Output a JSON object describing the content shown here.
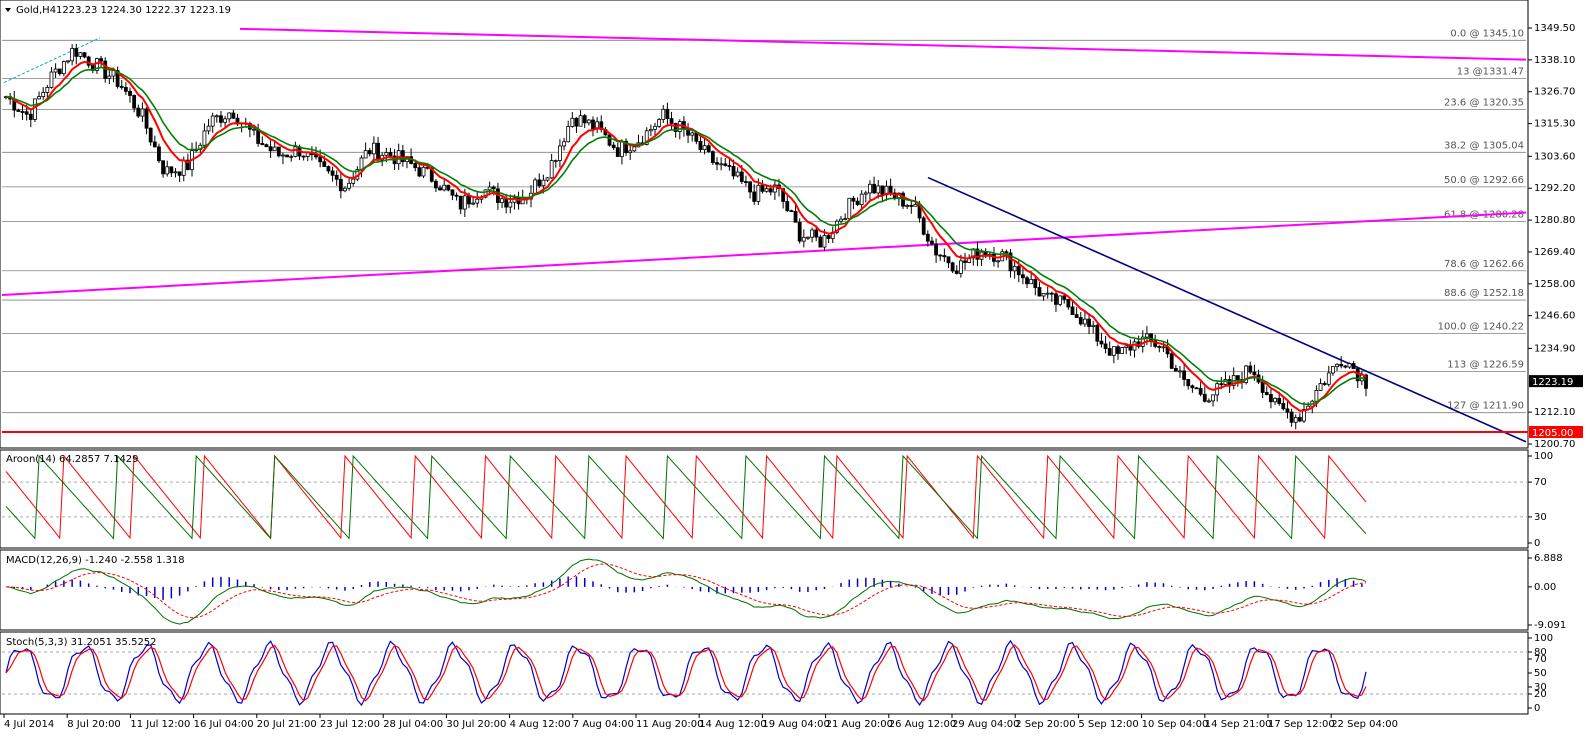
{
  "chart_data": {
    "type": "candlestick",
    "title": "Gold,H4",
    "ohlc": "1223.23 1224.30 1222.37 1223.19",
    "price_axis": {
      "ylim": [
        1200.7,
        1349.5
      ],
      "ticks": [
        "1349.50",
        "1338.10",
        "1326.70",
        "1315.30",
        "1303.60",
        "1292.20",
        "1280.80",
        "1269.40",
        "1258.00",
        "1246.60",
        "1234.90",
        "1212.10",
        "1200.70"
      ],
      "tick_values": [
        1349.5,
        1338.1,
        1326.7,
        1315.3,
        1303.6,
        1292.2,
        1280.8,
        1269.4,
        1258.0,
        1246.6,
        1234.9,
        1212.1,
        1200.7
      ],
      "current_price_label": "1223.19",
      "current_price": 1223.19,
      "support_label": "1205.00",
      "support_price": 1205.0
    },
    "time_axis": {
      "labels": [
        "4 Jul 2014",
        "8 Jul 20:00",
        "11 Jul 12:00",
        "16 Jul 04:00",
        "20 Jul 21:00",
        "23 Jul 12:00",
        "28 Jul 04:00",
        "30 Jul 20:00",
        "4 Aug 12:00",
        "7 Aug 04:00",
        "11 Aug 20:00",
        "14 Aug 12:00",
        "19 Aug 04:00",
        "21 Aug 20:00",
        "26 Aug 12:00",
        "29 Aug 04:00",
        "2 Sep 20:00",
        "5 Sep 12:00",
        "10 Sep 04:00",
        "14 Sep 21:00",
        "17 Sep 12:00",
        "22 Sep 04:00"
      ]
    },
    "fibonacci_levels": [
      {
        "label": "0.0 @ 1345.10",
        "price": 1345.1
      },
      {
        "label": "13 @1331.47",
        "price": 1331.47
      },
      {
        "label": "23.6 @ 1320.35",
        "price": 1320.35
      },
      {
        "label": "38.2 @ 1305.04",
        "price": 1305.04
      },
      {
        "label": "50.0 @ 1292.66",
        "price": 1292.66
      },
      {
        "label": "61.8 @ 1280.28",
        "price": 1280.28
      },
      {
        "label": "78.6 @ 1262.66",
        "price": 1262.66
      },
      {
        "label": "88.6 @ 1252.18",
        "price": 1252.18
      },
      {
        "label": "100.0 @ 1240.22",
        "price": 1240.22
      },
      {
        "label": "113 @ 1226.59",
        "price": 1226.59
      },
      {
        "label": "127 @ 1211.90",
        "price": 1211.9
      }
    ],
    "price_path": [
      1325,
      1318,
      1332,
      1342,
      1336,
      1330,
      1318,
      1298,
      1300,
      1316,
      1320,
      1310,
      1304,
      1306,
      1298,
      1293,
      1306,
      1304,
      1300,
      1295,
      1286,
      1292,
      1288,
      1290,
      1300,
      1318,
      1314,
      1306,
      1310,
      1318,
      1312,
      1303,
      1297,
      1290,
      1292,
      1276,
      1273,
      1284,
      1293,
      1290,
      1286,
      1270,
      1264,
      1270,
      1268,
      1260,
      1252,
      1250,
      1240,
      1232,
      1238,
      1236,
      1222,
      1218,
      1222,
      1228,
      1214,
      1210,
      1222,
      1232,
      1223
    ],
    "aroon": {
      "label": "Aroon(14) 64.2857 7.1429",
      "ylim": [
        0,
        100
      ],
      "ticks": [
        "100",
        "70",
        "30",
        "0"
      ],
      "tick_values": [
        100,
        70,
        30,
        0
      ],
      "aroon_up": 64.2857,
      "aroon_down": 7.1429
    },
    "macd": {
      "label": "MACD(12,26,9) -1.240 -2.558 1.318",
      "ylim": [
        -9.091,
        6.888
      ],
      "ticks": [
        "6.888",
        "0.00",
        "-9.091"
      ],
      "tick_values": [
        6.888,
        0.0,
        -9.091
      ]
    },
    "stoch": {
      "label": "Stoch(5,3,3) 31.2051 35.5252",
      "ylim": [
        0,
        100
      ],
      "ticks": [
        "100",
        "80",
        "70",
        "50",
        "30",
        "20",
        "0"
      ],
      "tick_values": [
        100,
        80,
        70,
        50,
        30,
        20,
        0
      ]
    },
    "colors": {
      "background": "#ffffff",
      "bull_candle": "#000000",
      "bear_candle": "#000000",
      "fast_ma": "#ff0000",
      "slow_ma": "#008000",
      "channel": "#ff00ff",
      "downtrend_line": "#000080",
      "support_line": "#ff0000",
      "fib_line": "#808080",
      "aroon_up": "#007000",
      "aroon_down": "#ff0000",
      "macd_hist": "#0000cc",
      "macd_signal": "#ff0000",
      "stoch_main": "#0000cc",
      "stoch_signal": "#ff0000",
      "price_label_bg": "#000000",
      "support_label_bg": "#ff0000"
    }
  }
}
